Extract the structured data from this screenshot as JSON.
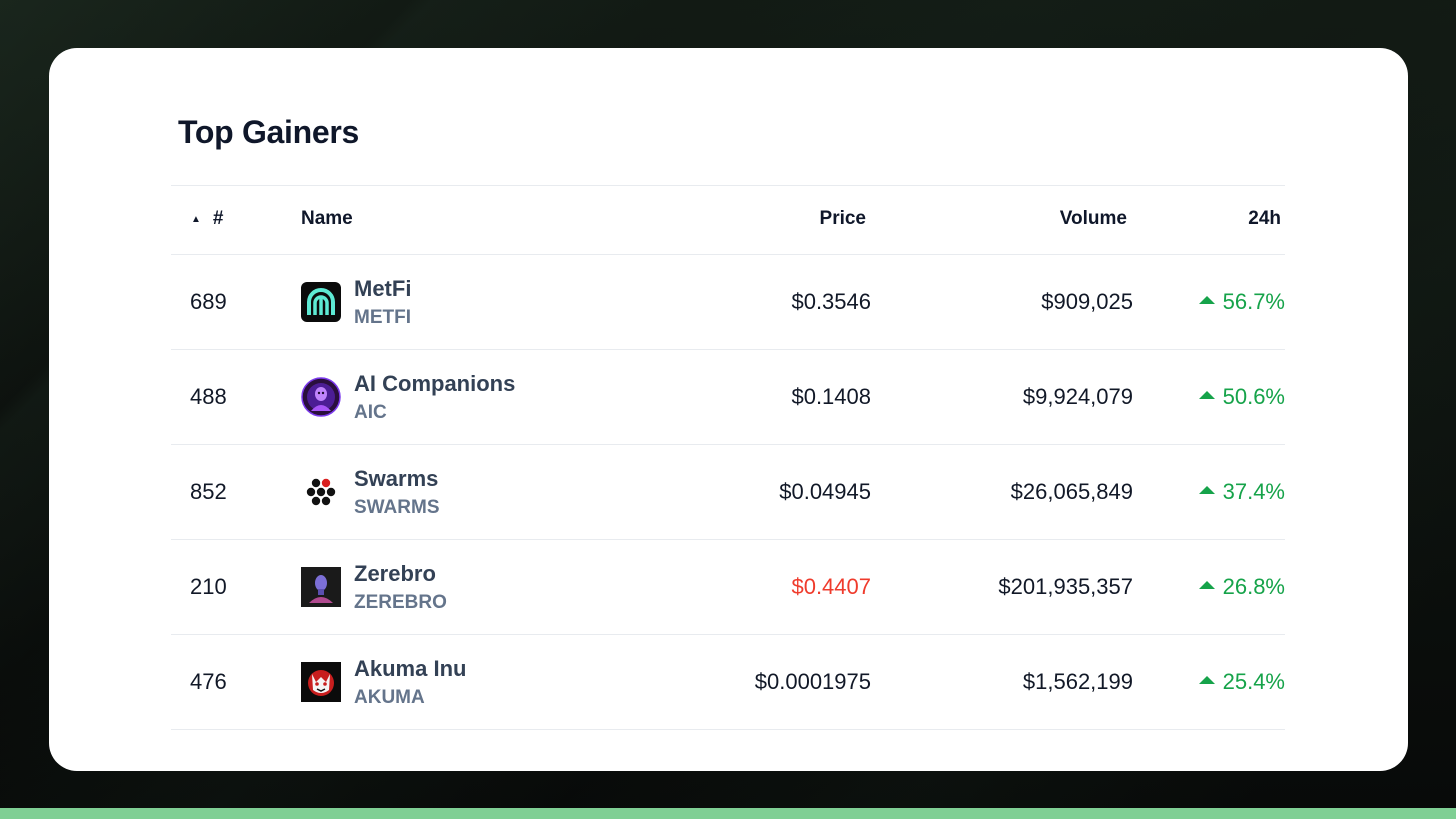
{
  "title": "Top Gainers",
  "columns": {
    "rank": "#",
    "name": "Name",
    "price": "Price",
    "volume": "Volume",
    "change": "24h"
  },
  "sort_icon": "triangle-up-icon",
  "colors": {
    "positive": "#16a34a",
    "negative": "#ef3b2c",
    "accent_bar": "#7fcf94"
  },
  "rows": [
    {
      "rank": "689",
      "name": "MetFi",
      "symbol": "METFI",
      "price": "$0.3546",
      "volume": "$909,025",
      "change": "56.7%",
      "logo_icon": "metfi-logo-icon"
    },
    {
      "rank": "488",
      "name": "AI Companions",
      "symbol": "AIC",
      "price": "$0.1408",
      "volume": "$9,924,079",
      "change": "50.6%",
      "logo_icon": "ai-companions-logo-icon"
    },
    {
      "rank": "852",
      "name": "Swarms",
      "symbol": "SWARMS",
      "price": "$0.04945",
      "volume": "$26,065,849",
      "change": "37.4%",
      "logo_icon": "swarms-logo-icon"
    },
    {
      "rank": "210",
      "name": "Zerebro",
      "symbol": "ZEREBRO",
      "price": "$0.4407",
      "volume": "$201,935,357",
      "change": "26.8%",
      "logo_icon": "zerebro-logo-icon"
    },
    {
      "rank": "476",
      "name": "Akuma Inu",
      "symbol": "AKUMA",
      "price": "$0.0001975",
      "volume": "$1,562,199",
      "change": "25.4%",
      "logo_icon": "akuma-inu-logo-icon"
    }
  ]
}
